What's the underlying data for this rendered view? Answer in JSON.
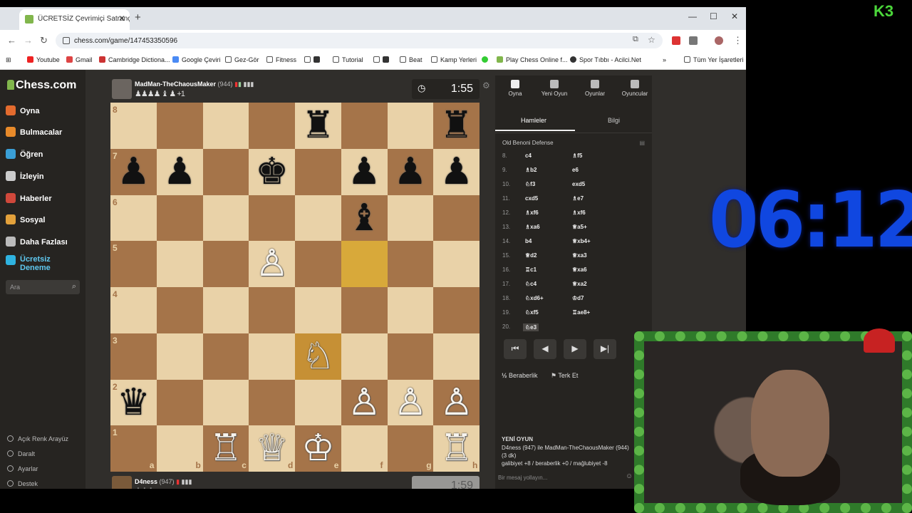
{
  "browser": {
    "tab_title": "ÜCRETSİZ Çevrimiçi Satranç Oy",
    "url": "chess.com/game/147453350596",
    "bookmarks": [
      "Youtube",
      "Gmail",
      "Cambridge Dictiona...",
      "Google Çeviri",
      "Gez-Gör",
      "Fitness",
      "Tutorial",
      "Beat",
      "Kamp Yerleri",
      "Play Chess Online f...",
      "Spor Tıbbı - Acilci.Net"
    ],
    "all_bookmarks": "Tüm Yer İşaretleri"
  },
  "sidebar": {
    "logo": "Chess.com",
    "items": [
      {
        "label": "Oyna",
        "color": "#e36b2e"
      },
      {
        "label": "Bulmacalar",
        "color": "#e88a2a"
      },
      {
        "label": "Öğren",
        "color": "#3a9fd6"
      },
      {
        "label": "İzleyin",
        "color": "#cccccc"
      },
      {
        "label": "Haberler",
        "color": "#d0483b"
      },
      {
        "label": "Sosyal",
        "color": "#e3a13b"
      },
      {
        "label": "Daha Fazlası",
        "color": "#bbbbbb"
      },
      {
        "label": "Ücretsiz Deneme",
        "color": "#2fb3e0"
      }
    ],
    "search_placeholder": "Ara",
    "bottom": [
      "Açık Renk Arayüz",
      "Daralt",
      "Ayarlar",
      "Destek"
    ]
  },
  "top_player": {
    "name": "MadMan-TheChaousMaker",
    "rating": "(944)",
    "captured": "♟♟♟♟ ♝ ♟ +1",
    "clock": "1:55"
  },
  "bottom_player": {
    "name": "D4ness",
    "rating": "(947)",
    "clock": "1:59"
  },
  "board": {
    "ranks": [
      "8",
      "7",
      "6",
      "5",
      "4",
      "3",
      "2",
      "1"
    ],
    "files": [
      "a",
      "b",
      "c",
      "d",
      "e",
      "f",
      "g",
      "h"
    ],
    "pieces": [
      {
        "sq": "e8",
        "glyph": "♜",
        "side": "b"
      },
      {
        "sq": "h8",
        "glyph": "♜",
        "side": "b"
      },
      {
        "sq": "a7",
        "glyph": "♟",
        "side": "b"
      },
      {
        "sq": "b7",
        "glyph": "♟",
        "side": "b"
      },
      {
        "sq": "d7",
        "glyph": "♚",
        "side": "b"
      },
      {
        "sq": "f7",
        "glyph": "♟",
        "side": "b"
      },
      {
        "sq": "g7",
        "glyph": "♟",
        "side": "b"
      },
      {
        "sq": "h7",
        "glyph": "♟",
        "side": "b"
      },
      {
        "sq": "f6",
        "glyph": "♝",
        "side": "b"
      },
      {
        "sq": "d5",
        "glyph": "♙",
        "side": "w"
      },
      {
        "sq": "e3",
        "glyph": "♘",
        "side": "w"
      },
      {
        "sq": "a2",
        "glyph": "♛",
        "side": "b"
      },
      {
        "sq": "f2",
        "glyph": "♙",
        "side": "w"
      },
      {
        "sq": "g2",
        "glyph": "♙",
        "side": "w"
      },
      {
        "sq": "h2",
        "glyph": "♙",
        "side": "w"
      },
      {
        "sq": "c1",
        "glyph": "♖",
        "side": "w"
      },
      {
        "sq": "d1",
        "glyph": "♕",
        "side": "w"
      },
      {
        "sq": "e1",
        "glyph": "♔",
        "side": "w"
      },
      {
        "sq": "h1",
        "glyph": "♖",
        "side": "w"
      }
    ],
    "highlights": [
      "f5",
      "e3"
    ]
  },
  "panel": {
    "tabs": [
      "Oyna",
      "Yeni Oyun",
      "Oyunlar",
      "Oyuncular"
    ],
    "subtabs": [
      "Hamleler",
      "Bilgi"
    ],
    "opening": "Old Benoni Defense",
    "moves": [
      {
        "n": "8.",
        "w": "c4",
        "b": "♗f5"
      },
      {
        "n": "9.",
        "w": "♗b2",
        "b": "e6"
      },
      {
        "n": "10.",
        "w": "♘f3",
        "b": "exd5"
      },
      {
        "n": "11.",
        "w": "cxd5",
        "b": "♗e7"
      },
      {
        "n": "12.",
        "w": "♗xf6",
        "b": "♗xf6"
      },
      {
        "n": "13.",
        "w": "♗xa6",
        "b": "♕a5+"
      },
      {
        "n": "14.",
        "w": "b4",
        "b": "♕xb4+"
      },
      {
        "n": "15.",
        "w": "♕d2",
        "b": "♕xa3"
      },
      {
        "n": "16.",
        "w": "♖c1",
        "b": "♕xa6"
      },
      {
        "n": "17.",
        "w": "♘c4",
        "b": "♕xa2"
      },
      {
        "n": "18.",
        "w": "♘xd6+",
        "b": "♔d7"
      },
      {
        "n": "19.",
        "w": "♘xf5",
        "b": "♖ae8+"
      },
      {
        "n": "20.",
        "w": "♘e3",
        "b": ""
      }
    ],
    "controls": [
      "⏮",
      "◀",
      "▶",
      "▶|"
    ],
    "draw": "Beraberlik",
    "resign": "Terk Et",
    "new_game_title": "YENİ OYUN",
    "new_game_line1": "D4ness (947) ile MadMan-TheChaousMaker (944)",
    "new_game_line2": "(3 dk)",
    "new_game_line3": "galibiyet +8 / beraberlik +0 / mağlubiyet -8",
    "message_placeholder": "Bir mesaj yollayın..."
  },
  "overlay": {
    "timer": "06:12",
    "logo_k": "K",
    "logo_3": "3"
  }
}
